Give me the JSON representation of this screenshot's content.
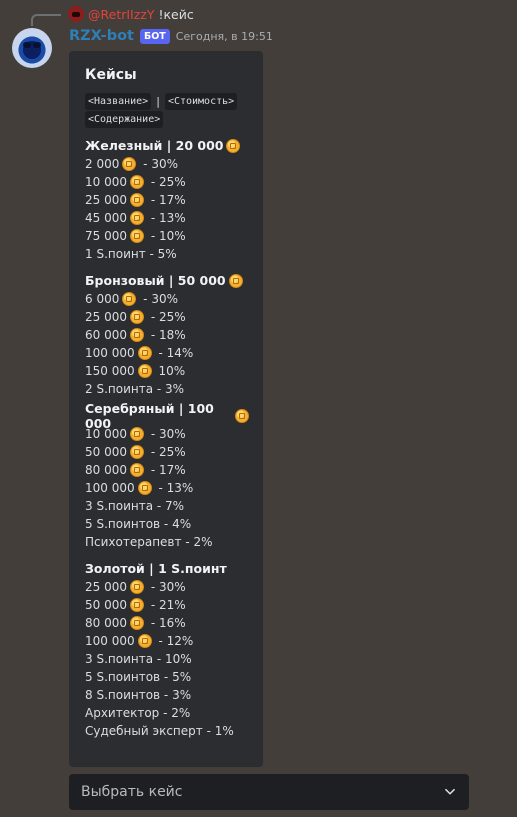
{
  "reply": {
    "username": "@RetrIIzzY",
    "text": "!кейс"
  },
  "author": {
    "name": "RZX-bot",
    "badge": "БОТ",
    "timestamp": "Сегодня, в 19:51"
  },
  "embed": {
    "title": "Кейсы",
    "legend": [
      "<Название>",
      "|",
      "<Стоимость>",
      "<Содержание>"
    ],
    "sections": [
      {
        "title": "Железный | 20 000",
        "title_coin": true,
        "rows": [
          {
            "value": "2 000",
            "coin": true,
            "chance": " - 30%"
          },
          {
            "value": "10 000",
            "coin": true,
            "chance": " - 25%"
          },
          {
            "value": "25 000",
            "coin": true,
            "chance": " - 17%"
          },
          {
            "value": "45 000",
            "coin": true,
            "chance": " - 13%"
          },
          {
            "value": "75 000",
            "coin": true,
            "chance": " - 10%"
          },
          {
            "value": "1 S.поинт - 5%",
            "coin": false,
            "chance": ""
          }
        ]
      },
      {
        "title": "Бронзовый | 50 000",
        "title_coin": true,
        "rows": [
          {
            "value": "6 000",
            "coin": true,
            "chance": " - 30%"
          },
          {
            "value": "25 000",
            "coin": true,
            "chance": " - 25%"
          },
          {
            "value": "60 000",
            "coin": true,
            "chance": " - 18%"
          },
          {
            "value": "100 000",
            "coin": true,
            "chance": " - 14%"
          },
          {
            "value": "150 000",
            "coin": true,
            "chance": " 10%"
          },
          {
            "value": "2 S.поинта - 3%",
            "coin": false,
            "chance": ""
          }
        ]
      },
      {
        "title": "Серебряный | 100 000",
        "title_coin": true,
        "rows": [
          {
            "value": "10 000",
            "coin": true,
            "chance": " - 30%"
          },
          {
            "value": "50 000",
            "coin": true,
            "chance": " - 25%"
          },
          {
            "value": "80 000",
            "coin": true,
            "chance": " - 17%"
          },
          {
            "value": "100 000",
            "coin": true,
            "chance": " - 13%"
          },
          {
            "value": "3 S.поинта - 7%",
            "coin": false,
            "chance": ""
          },
          {
            "value": "5 S.поинтов - 4%",
            "coin": false,
            "chance": ""
          },
          {
            "value": "Психотерапевт - 2%",
            "coin": false,
            "chance": ""
          }
        ]
      },
      {
        "title": "Золотой | 1 S.поинт",
        "title_coin": false,
        "rows": [
          {
            "value": "25 000",
            "coin": true,
            "chance": " - 30%"
          },
          {
            "value": "50 000",
            "coin": true,
            "chance": " - 21%"
          },
          {
            "value": "80 000",
            "coin": true,
            "chance": " - 16%"
          },
          {
            "value": "100 000",
            "coin": true,
            "chance": " - 12%"
          },
          {
            "value": "3 S.поинта - 10%",
            "coin": false,
            "chance": ""
          },
          {
            "value": "5 S.поинтов - 5%",
            "coin": false,
            "chance": ""
          },
          {
            "value": "8 S.поинтов - 3%",
            "coin": false,
            "chance": ""
          },
          {
            "value": "Архитектор - 2%",
            "coin": false,
            "chance": ""
          },
          {
            "value": "Судебный эксперт - 1%",
            "coin": false,
            "chance": ""
          }
        ]
      }
    ]
  },
  "select": {
    "placeholder": "Выбрать кейс"
  }
}
